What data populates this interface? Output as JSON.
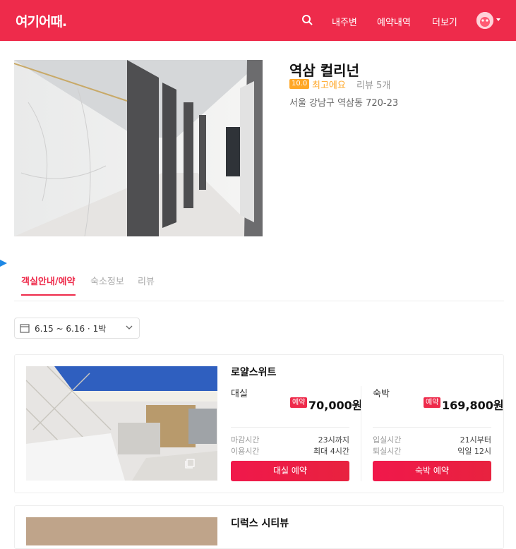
{
  "header": {
    "logo": "여기어때.",
    "nav": [
      "내주변",
      "예약내역",
      "더보기"
    ]
  },
  "hotel": {
    "name": "역삼 컬리넌",
    "score": "10.0",
    "score_text": "최고에요",
    "review_count": "리뷰 5개",
    "address": "서울 강남구 역삼동 720-23"
  },
  "tabs": [
    "객실안내/예약",
    "숙소정보",
    "리뷰"
  ],
  "date_range": "6.15 ~ 6.16 · 1박",
  "rooms": [
    {
      "name": "로얄스위트",
      "rent": {
        "label": "대실",
        "badge": "예약",
        "price": "70,000원",
        "k1": "마감시간",
        "v1": "23시까지",
        "k2": "이용시간",
        "v2": "최대 4시간",
        "button": "대실 예약"
      },
      "stay": {
        "label": "숙박",
        "badge": "예약",
        "price": "169,800원",
        "k1": "입실시간",
        "v1": "21시부터",
        "k2": "퇴실시간",
        "v2": "익일 12시",
        "button": "숙박 예약"
      }
    },
    {
      "name": "디럭스 시티뷰"
    }
  ],
  "colors": {
    "brand": "#ee2b4b",
    "score": "#ffa726"
  }
}
